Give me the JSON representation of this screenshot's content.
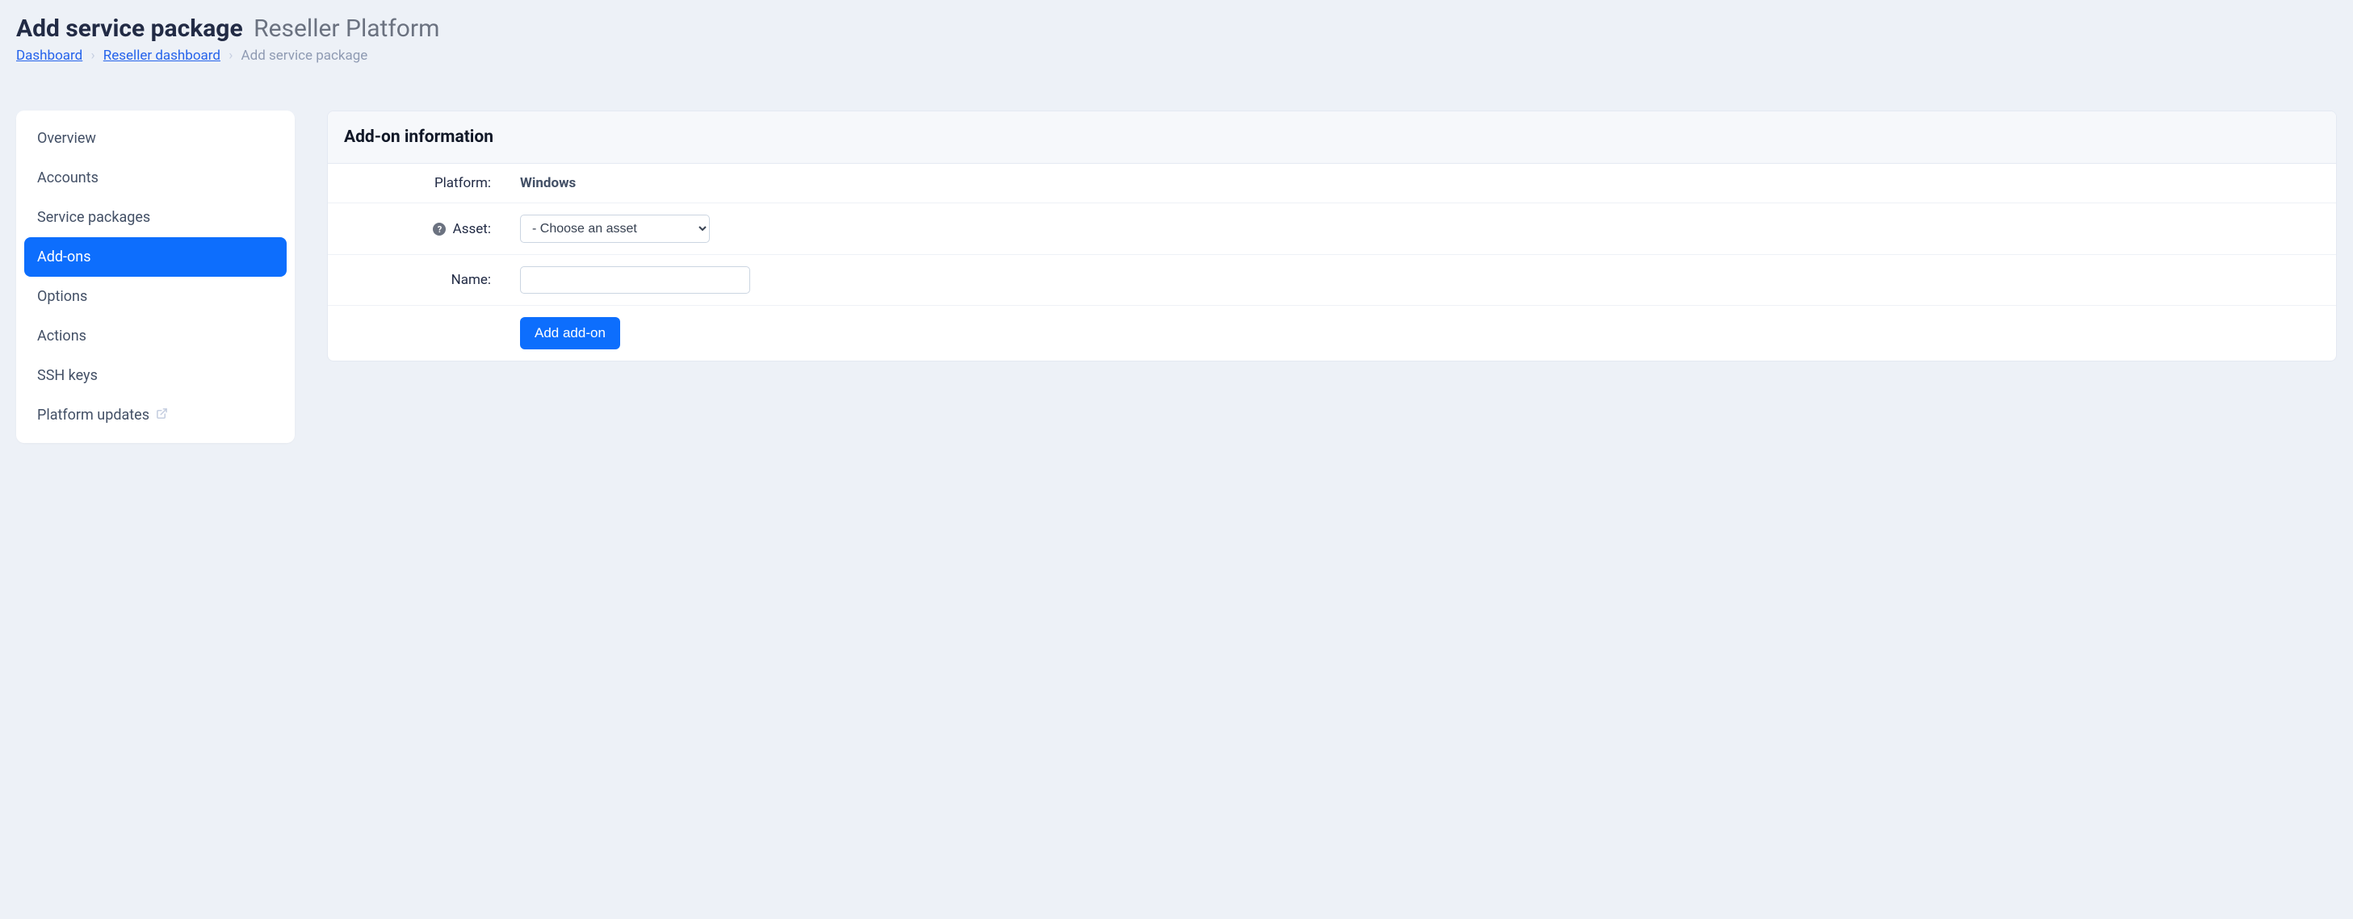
{
  "header": {
    "title": "Add service package",
    "subtitle": "Reseller Platform"
  },
  "breadcrumb": {
    "items": [
      "Dashboard",
      "Reseller dashboard",
      "Add service package"
    ]
  },
  "sidebar": {
    "items": [
      {
        "label": "Overview",
        "active": false,
        "external": false
      },
      {
        "label": "Accounts",
        "active": false,
        "external": false
      },
      {
        "label": "Service packages",
        "active": false,
        "external": false
      },
      {
        "label": "Add-ons",
        "active": true,
        "external": false
      },
      {
        "label": "Options",
        "active": false,
        "external": false
      },
      {
        "label": "Actions",
        "active": false,
        "external": false
      },
      {
        "label": "SSH keys",
        "active": false,
        "external": false
      },
      {
        "label": "Platform updates",
        "active": false,
        "external": true
      }
    ]
  },
  "panel": {
    "title": "Add-on information",
    "platform_label": "Platform:",
    "platform_value": "Windows",
    "asset_label": "Asset:",
    "asset_select_placeholder": "- Choose an asset",
    "name_label": "Name:",
    "name_value": "",
    "submit_label": "Add add-on"
  }
}
